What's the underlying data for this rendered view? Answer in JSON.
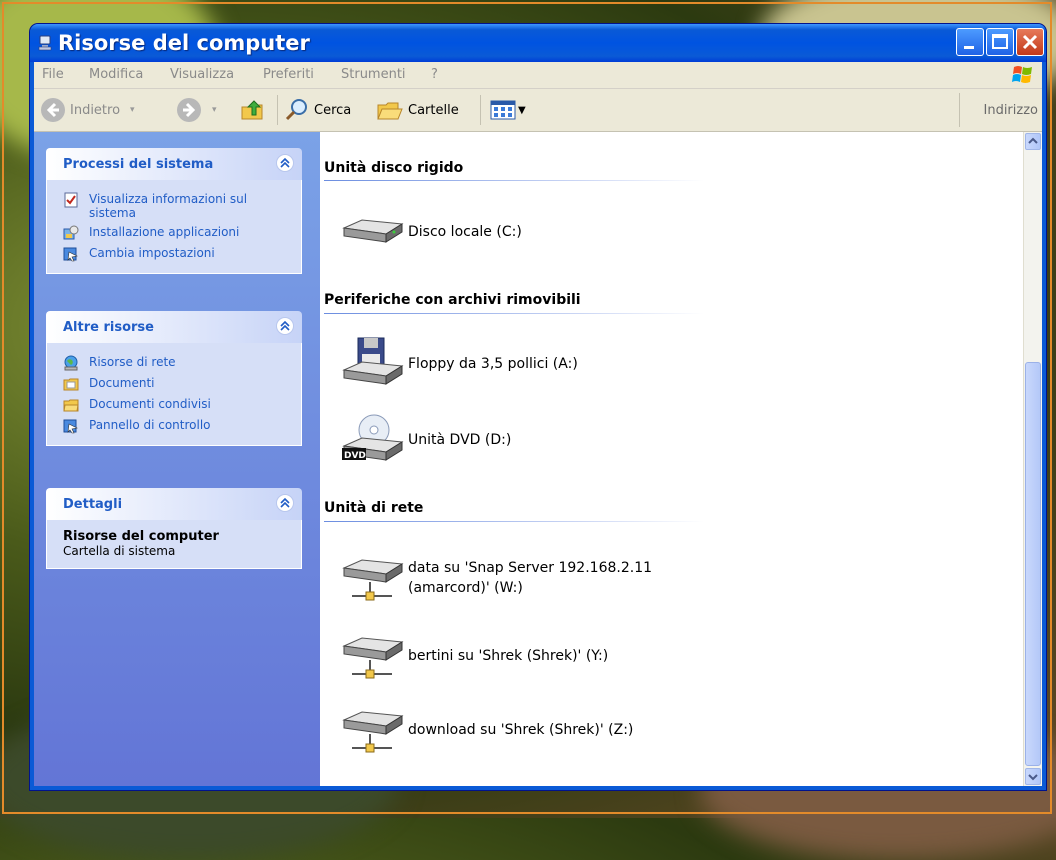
{
  "window": {
    "title": "Risorse del computer",
    "accent": "#0a5ad6"
  },
  "menubar": {
    "items": [
      "File",
      "Modifica",
      "Visualizza",
      "Preferiti",
      "Strumenti",
      "?"
    ]
  },
  "toolbar": {
    "back_label": "Indietro",
    "search_label": "Cerca",
    "folders_label": "Cartelle",
    "address_label": "Indirizzo"
  },
  "left_pane": {
    "system_tasks": {
      "title": "Processi del sistema",
      "links": [
        {
          "label": "Visualizza informazioni sul sistema",
          "icon": "system-info-icon"
        },
        {
          "label": "Installazione applicazioni",
          "icon": "add-remove-programs-icon"
        },
        {
          "label": "Cambia impostazioni",
          "icon": "control-panel-icon"
        }
      ]
    },
    "other_places": {
      "title": "Altre risorse",
      "links": [
        {
          "label": "Risorse di rete",
          "icon": "network-places-icon"
        },
        {
          "label": "Documenti",
          "icon": "documents-folder-icon"
        },
        {
          "label": "Documenti condivisi",
          "icon": "shared-folder-icon"
        },
        {
          "label": "Pannello di controllo",
          "icon": "control-panel-icon"
        }
      ]
    },
    "details": {
      "title": "Dettagli",
      "name": "Risorse del computer",
      "type": "Cartella di sistema"
    }
  },
  "main": {
    "groups": [
      {
        "title": "Unità disco rigido",
        "items": [
          {
            "label": "Disco locale (C:)",
            "icon": "hard-disk-icon"
          }
        ]
      },
      {
        "title": "Periferiche con archivi rimovibili",
        "items": [
          {
            "label": "Floppy da 3,5 pollici (A:)",
            "icon": "floppy-drive-icon"
          },
          {
            "label": "Unità DVD (D:)",
            "icon": "dvd-drive-icon"
          }
        ]
      },
      {
        "title": "Unità di rete",
        "items": [
          {
            "label_line1": "data su 'Snap Server 192.168.2.11",
            "label_line2": "(amarcord)' (W:)",
            "icon": "network-drive-icon"
          },
          {
            "label": "bertini su 'Shrek (Shrek)' (Y:)",
            "icon": "network-drive-icon"
          },
          {
            "label": "download su 'Shrek (Shrek)' (Z:)",
            "icon": "network-drive-icon"
          }
        ]
      }
    ]
  }
}
